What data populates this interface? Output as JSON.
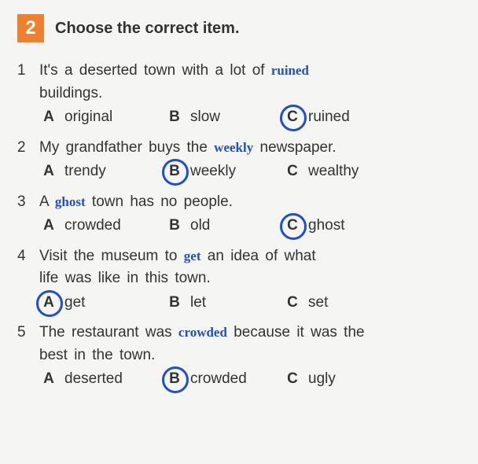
{
  "header": {
    "number": "2",
    "instruction": "Choose the correct item."
  },
  "questions": [
    {
      "num": "1",
      "pre": "It's  a  deserted  town  with  a  lot  of ",
      "fill": "ruined",
      "post": "",
      "cont": "buildings.",
      "options": [
        {
          "letter": "A",
          "text": "original",
          "circled": false
        },
        {
          "letter": "B",
          "text": "slow",
          "circled": false
        },
        {
          "letter": "C",
          "text": "ruined",
          "circled": true
        }
      ]
    },
    {
      "num": "2",
      "pre": "My grandfather buys the ",
      "fill": "weekly",
      "post": " newspaper.",
      "cont": "",
      "options": [
        {
          "letter": "A",
          "text": "trendy",
          "circled": false
        },
        {
          "letter": "B",
          "text": "weekly",
          "circled": true
        },
        {
          "letter": "C",
          "text": "wealthy",
          "circled": false
        }
      ]
    },
    {
      "num": "3",
      "pre": "A ",
      "fill": "ghost",
      "post": " town has no people.",
      "cont": "",
      "options": [
        {
          "letter": "A",
          "text": "crowded",
          "circled": false
        },
        {
          "letter": "B",
          "text": "old",
          "circled": false
        },
        {
          "letter": "C",
          "text": "ghost",
          "circled": true
        }
      ]
    },
    {
      "num": "4",
      "pre": "Visit  the  museum  to ",
      "fill": "get",
      "post": "   an  idea  of  what",
      "cont": "life was like in this town.",
      "options": [
        {
          "letter": "A",
          "text": "get",
          "circled": true
        },
        {
          "letter": "B",
          "text": "let",
          "circled": false
        },
        {
          "letter": "C",
          "text": "set",
          "circled": false
        }
      ]
    },
    {
      "num": "5",
      "pre": "The  restaurant  was ",
      "fill": "crowded",
      "post": " because  it  was  the",
      "cont": "best in the town.",
      "options": [
        {
          "letter": "A",
          "text": "deserted",
          "circled": false
        },
        {
          "letter": "B",
          "text": "crowded",
          "circled": true
        },
        {
          "letter": "C",
          "text": "ugly",
          "circled": false
        }
      ]
    }
  ]
}
